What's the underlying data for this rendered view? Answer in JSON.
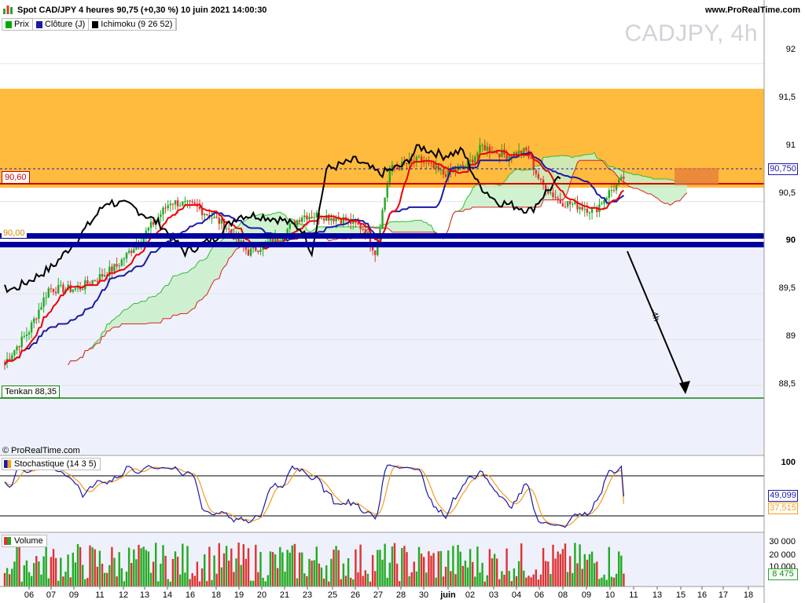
{
  "header": {
    "title": "Spot CAD/JPY 4 heures 90,75 (+0,30 %) 10 juin 2021 14:00:30",
    "site": "www.ProRealTime.com"
  },
  "legend": [
    {
      "label": "Prix",
      "color": "#00aa00"
    },
    {
      "label": "Clôture (J)",
      "color": "#1a1aa6"
    },
    {
      "label": "Ichimoku (9 26 52)",
      "color": "#000000"
    }
  ],
  "watermark": "CADJPY, 4h",
  "copyright": "© ProRealTime.com",
  "price_axis": {
    "ticks": [
      "92",
      "91,5",
      "91",
      "90,5",
      "90",
      "89,5",
      "89",
      "88,5"
    ]
  },
  "price_tags": {
    "last": "90,750",
    "level_9060": "90,60",
    "level_9000": "90,00",
    "tenkan": "Tenkan 88,35"
  },
  "arrow_label": "-4h",
  "x_axis": {
    "ticks": [
      "06",
      "07",
      "09",
      "11",
      "12",
      "13",
      "14",
      "16",
      "18",
      "19",
      "20",
      "21",
      "23",
      "25",
      "26",
      "27",
      "28",
      "30",
      "juin",
      "02",
      "03",
      "04",
      "06",
      "08",
      "09",
      "10",
      "11",
      "13",
      "15",
      "16",
      "17",
      "18"
    ]
  },
  "stochastic": {
    "title": "Stochastique (14 3 5)",
    "top_tick": "100",
    "k_value": "49,099",
    "d_value": "37,515"
  },
  "volume": {
    "title": "Volume",
    "ticks": [
      "30 000",
      "20 000",
      "10 000"
    ],
    "last": "8 475"
  },
  "colors": {
    "resistance_zone": "#ffb733",
    "support_band": "#0000a0",
    "bull": "#22aa22",
    "bear": "#dd3333",
    "kijun": "#1a1aa6",
    "tenkan": "#ee0000",
    "chikou": "#000000",
    "cloud_bull": "#c8f0c8",
    "cloud_edge_bull": "#33bb33",
    "cloud_edge_bear": "#dd2222",
    "stoch_k": "#1a1aa6",
    "stoch_d": "#f39c1f",
    "chart_bg": "#eef1fb"
  },
  "chart_data": [
    {
      "type": "candlestick",
      "title": "Spot CAD/JPY 4 heures",
      "ylim": [
        87.75,
        92.35
      ],
      "y_ticks": [
        88.5,
        89,
        89.5,
        90,
        90.5,
        91,
        91.5,
        92
      ],
      "zones": {
        "resistance": [
          90.6,
          91.55
        ],
        "support": [
          89.94,
          90.05
        ]
      },
      "horizontal_lines": [
        90.6,
        90.0,
        88.35
      ],
      "last_price": 90.75,
      "ichimoku_params": [
        9,
        26,
        52
      ],
      "close_start": 88.75,
      "close_anchors": [
        [
          0,
          88.75
        ],
        [
          10,
          89.1
        ],
        [
          18,
          89.55
        ],
        [
          30,
          89.55
        ],
        [
          40,
          89.7
        ],
        [
          46,
          89.8
        ],
        [
          56,
          90.1
        ],
        [
          68,
          90.5
        ],
        [
          78,
          90.45
        ],
        [
          90,
          90.25
        ],
        [
          100,
          89.95
        ],
        [
          112,
          90.1
        ],
        [
          122,
          90.35
        ],
        [
          130,
          90.35
        ],
        [
          140,
          90.3
        ],
        [
          148,
          90.2
        ],
        [
          152,
          89.95
        ],
        [
          158,
          90.85
        ],
        [
          170,
          90.95
        ],
        [
          180,
          90.8
        ],
        [
          190,
          90.9
        ],
        [
          196,
          91.1
        ],
        [
          206,
          91.0
        ],
        [
          214,
          91.05
        ],
        [
          220,
          90.7
        ],
        [
          228,
          90.5
        ],
        [
          236,
          90.45
        ],
        [
          242,
          90.4
        ],
        [
          248,
          90.6
        ],
        [
          254,
          90.75
        ]
      ]
    },
    {
      "type": "line",
      "title": "Stochastique (14 3 5)",
      "ylim": [
        0,
        100
      ],
      "levels": [
        80,
        20
      ],
      "series": [
        {
          "name": "%K",
          "last": 49.099
        },
        {
          "name": "%D",
          "last": 37.515
        }
      ]
    },
    {
      "type": "bar",
      "title": "Volume",
      "ylim": [
        0,
        35000
      ],
      "y_ticks": [
        10000,
        20000,
        30000
      ],
      "last": 8475
    }
  ]
}
